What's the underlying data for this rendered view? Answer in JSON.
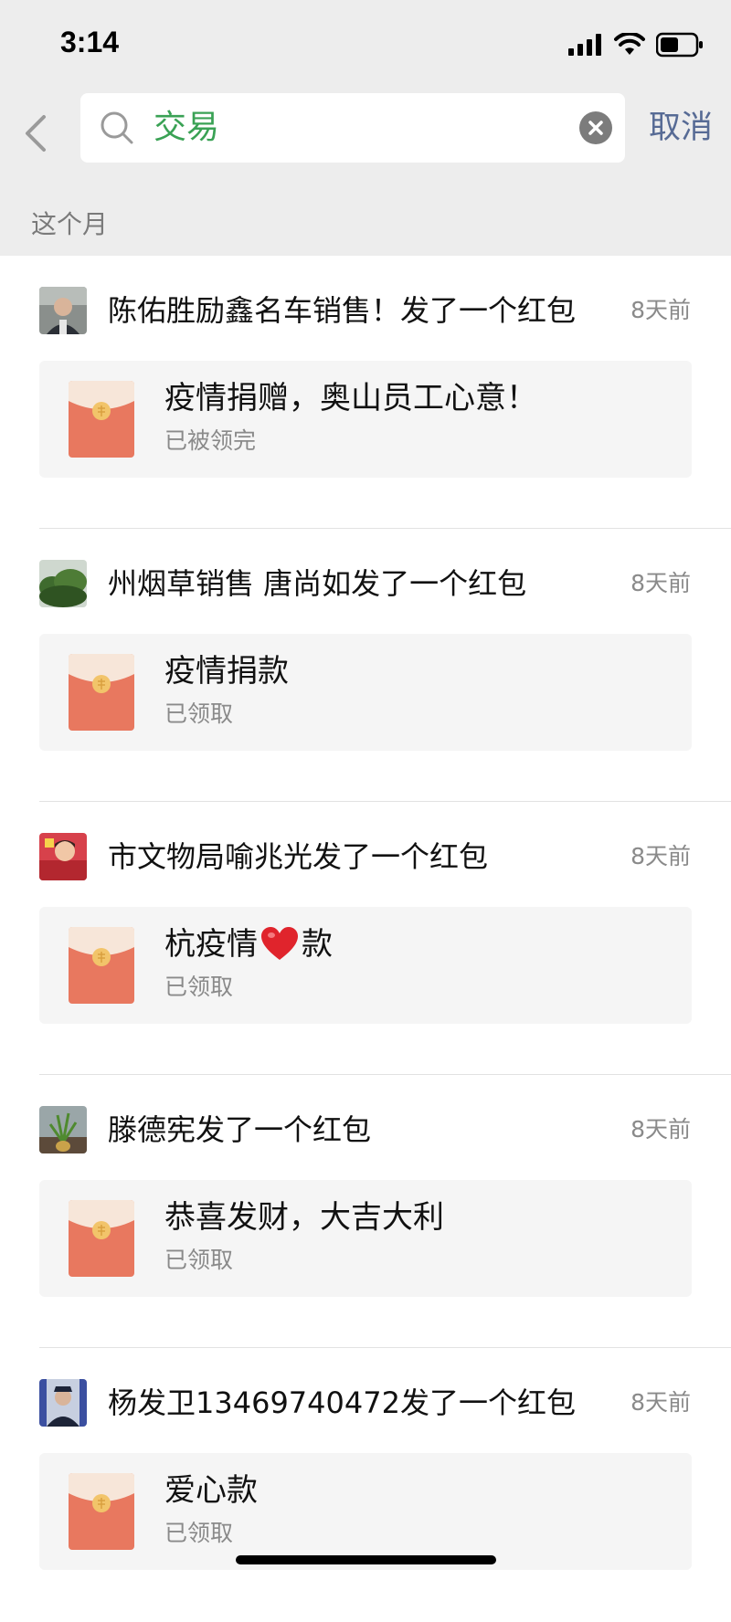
{
  "status_bar": {
    "time": "3:14"
  },
  "search": {
    "query": "交易",
    "cancel_label": "取消"
  },
  "section_header": "这个月",
  "items": [
    {
      "sender": "陈佑胜励鑫名车销售！发了一个红包",
      "time": "8天前",
      "title": "疫情捐赠，奥山员工心意！",
      "title_b": "",
      "status": "已被领完"
    },
    {
      "sender": "州烟草销售 唐尚如发了一个红包",
      "time": "8天前",
      "title": "疫情捐款",
      "title_b": "",
      "status": "已领取"
    },
    {
      "sender": "市文物局喻兆光发了一个红包",
      "time": "8天前",
      "title": "杭疫情",
      "title_b": "款",
      "status": "已领取"
    },
    {
      "sender": "滕德宪发了一个红包",
      "time": "8天前",
      "title": "恭喜发财，大吉大利",
      "title_b": "",
      "status": "已领取"
    },
    {
      "sender": "杨发卫13469740472发了一个红包",
      "time": "8天前",
      "title": "爱心款",
      "title_b": "",
      "status": "已领取"
    }
  ],
  "colors": {
    "accent_green": "#3aa255",
    "link_blue": "#576b95",
    "envelope_red": "#e8785f",
    "envelope_flap": "#f7e6d9",
    "seal_gold": "#f2c46a"
  }
}
